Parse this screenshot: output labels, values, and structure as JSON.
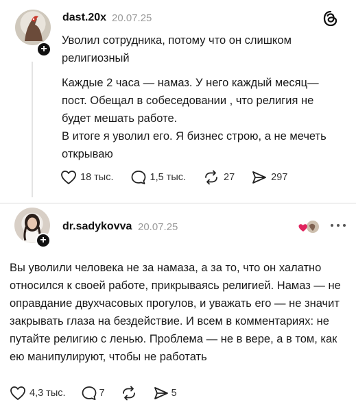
{
  "post1": {
    "username": "dast.20x",
    "date": "20.07.25",
    "paragraphs": [
      "Уволил сотрудника, потому что он слишком религиозный",
      "Каждые 2 часа — намаз. У него каждый месяц— пост. Обещал в собеседовании , что религия не будет мешать работе.",
      "В итоге я уволил его. Я бизнес строю, а не мечеть открываю"
    ],
    "actions": {
      "likes": "18 тыс.",
      "comments": "1,5 тыс.",
      "reposts": "27",
      "shares": "297"
    },
    "icons": {
      "like": "heart-icon",
      "comment": "comment-icon",
      "repost": "repost-icon",
      "share": "share-icon",
      "app": "threads-logo-icon",
      "follow": "plus-icon"
    }
  },
  "post2": {
    "username": "dr.sadykovva",
    "date": "20.07.25",
    "text": "Вы уволили человека не за намаза, а за то, что он халатно относился к своей работе, прикрываясь религией. Намаз — не оправдание двухчасовых прогулов, и уважать его — не значит закрывать глаза на бездействие. И всем в комментариях: не путайте религию с ленью. Проблема — не в вере, а в том, как ею манипулируют, чтобы не работать",
    "actions": {
      "likes": "4,3 тыс.",
      "comments": "7",
      "reposts": "",
      "shares": "5"
    },
    "icons": {
      "liked_by_author": "heart-avatar-icon",
      "more": "more-icon",
      "follow": "plus-icon"
    }
  },
  "colors": {
    "text": "#1a1a1a",
    "muted": "#9a9a9a",
    "accent_like": "#e0245e",
    "divider": "#d9d9d9"
  }
}
